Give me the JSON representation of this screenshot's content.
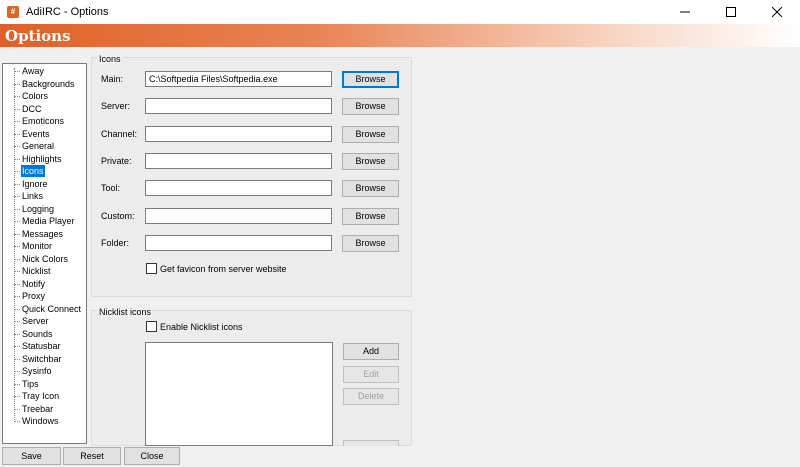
{
  "window": {
    "title": "AdiIRC - Options",
    "app_icon_glyph": "#"
  },
  "banner": {
    "title": "Options"
  },
  "tree": {
    "items": [
      "Away",
      "Backgrounds",
      "Colors",
      "DCC",
      "Emoticons",
      "Events",
      "General",
      "Highlights",
      "Icons",
      "Ignore",
      "Links",
      "Logging",
      "Media Player",
      "Messages",
      "Monitor",
      "Nick Colors",
      "Nicklist",
      "Notify",
      "Proxy",
      "Quick Connect",
      "Server",
      "Sounds",
      "Statusbar",
      "Switchbar",
      "Sysinfo",
      "Tips",
      "Tray Icon",
      "Treebar",
      "Windows"
    ],
    "selected": "Icons"
  },
  "icons_group": {
    "title": "Icons",
    "fields": [
      {
        "label": "Main:",
        "value": "C:\\Softpedia Files\\Softpedia.exe",
        "button": "Browse"
      },
      {
        "label": "Server:",
        "value": "",
        "button": "Browse"
      },
      {
        "label": "Channel:",
        "value": "",
        "button": "Browse"
      },
      {
        "label": "Private:",
        "value": "",
        "button": "Browse"
      },
      {
        "label": "Tool:",
        "value": "",
        "button": "Browse"
      },
      {
        "label": "Custom:",
        "value": "",
        "button": "Browse"
      },
      {
        "label": "Folder:",
        "value": "",
        "button": "Browse"
      }
    ],
    "favicon_checkbox": {
      "label": "Get favicon from server website",
      "checked": false
    }
  },
  "nicklist_group": {
    "title": "Nicklist icons",
    "enable_checkbox": {
      "label": "Enable Nicklist icons",
      "checked": false
    },
    "add_button": "Add",
    "edit_button": "Edit",
    "delete_button": "Delete"
  },
  "footer": {
    "save": "Save",
    "reset": "Reset",
    "close": "Close"
  },
  "colors": {
    "accent": "#0078d7",
    "banner_start": "#df6127",
    "selection": "#0078d7"
  }
}
